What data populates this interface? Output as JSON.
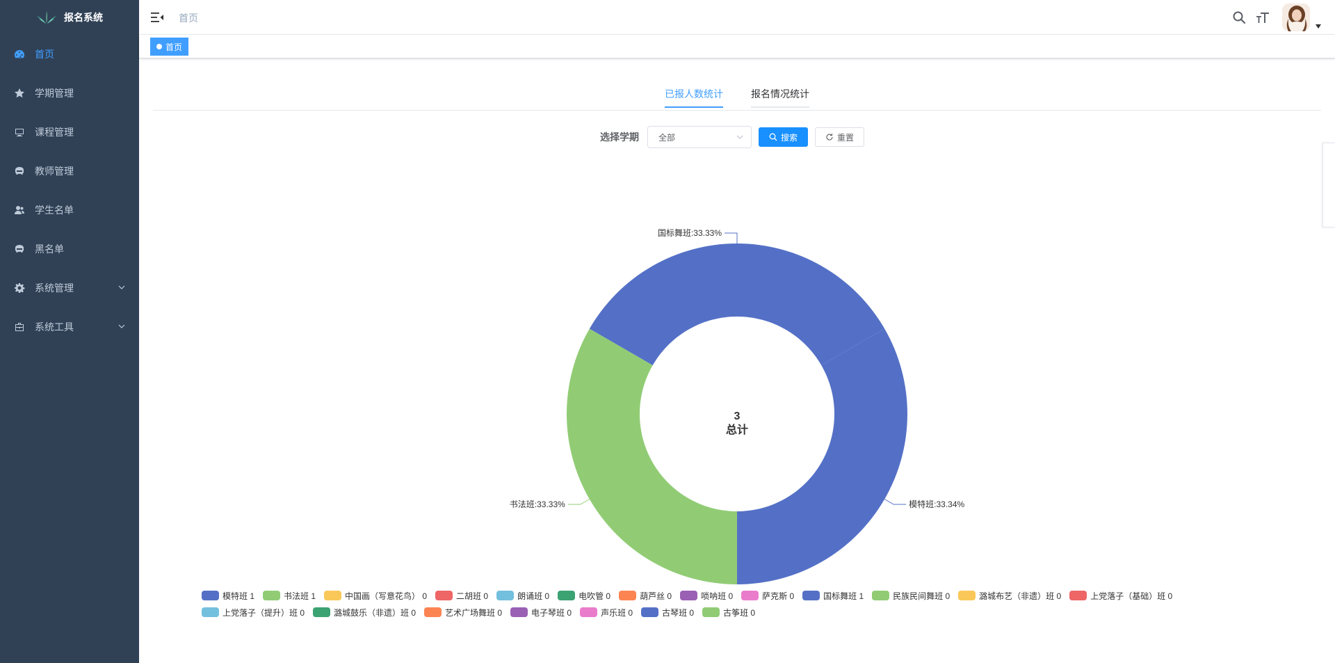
{
  "app": {
    "title": "报名系统"
  },
  "sidebar": {
    "items": [
      {
        "label": "首页",
        "icon": "dashboard-icon",
        "active": true
      },
      {
        "label": "学期管理",
        "icon": "star-icon"
      },
      {
        "label": "课程管理",
        "icon": "monitor-icon"
      },
      {
        "label": "教师管理",
        "icon": "education-icon"
      },
      {
        "label": "学生名单",
        "icon": "peoples-icon"
      },
      {
        "label": "黑名单",
        "icon": "education-icon"
      },
      {
        "label": "系统管理",
        "icon": "gear-icon",
        "expandable": true
      },
      {
        "label": "系统工具",
        "icon": "toolbox-icon",
        "expandable": true
      }
    ]
  },
  "header": {
    "breadcrumb": "首页"
  },
  "tags_view": {
    "tags": [
      {
        "label": "首页",
        "active": true
      }
    ]
  },
  "tabs": [
    {
      "label": "已报人数统计",
      "active": true
    },
    {
      "label": "报名情况统计",
      "active": false
    }
  ],
  "filter": {
    "label": "选择学期",
    "select_value": "全部",
    "search_label": "搜索",
    "reset_label": "重置"
  },
  "colors": {
    "accent": "#409eff",
    "sidebar_bg": "#304156",
    "primary_button": "#1890ff"
  },
  "chart_data": {
    "type": "pie",
    "variant": "donut",
    "center_text": {
      "value": "3",
      "label": "总计"
    },
    "slices": [
      {
        "name": "模特班",
        "value": 1,
        "label": "模特班:33.34%",
        "color": "#5470c6"
      },
      {
        "name": "书法班",
        "value": 1,
        "label": "书法班:33.33%",
        "color": "#91cc75"
      },
      {
        "name": "国标舞班",
        "value": 1,
        "label": "国标舞班:33.33%",
        "color": "#5470c6"
      }
    ],
    "legend": [
      {
        "name": "模特班",
        "value": 1,
        "color": "#5470c6"
      },
      {
        "name": "书法班",
        "value": 1,
        "color": "#91cc75"
      },
      {
        "name": "中国画（写意花鸟）",
        "value": 0,
        "color": "#fac858"
      },
      {
        "name": "二胡班",
        "value": 0,
        "color": "#ee6666"
      },
      {
        "name": "朗诵班",
        "value": 0,
        "color": "#73c0de"
      },
      {
        "name": "电吹管",
        "value": 0,
        "color": "#3ba272"
      },
      {
        "name": "葫芦丝",
        "value": 0,
        "color": "#fc8452"
      },
      {
        "name": "唢呐班",
        "value": 0,
        "color": "#9a60b4"
      },
      {
        "name": "萨克斯",
        "value": 0,
        "color": "#ea7ccc"
      },
      {
        "name": "国标舞班",
        "value": 1,
        "color": "#5470c6"
      },
      {
        "name": "民族民间舞班",
        "value": 0,
        "color": "#91cc75"
      },
      {
        "name": "潞城布艺（非遗）班",
        "value": 0,
        "color": "#fac858"
      },
      {
        "name": "上党落子（基础）班",
        "value": 0,
        "color": "#ee6666"
      },
      {
        "name": "上党落子（提升）班",
        "value": 0,
        "color": "#73c0de"
      },
      {
        "name": "潞城鼓乐（非遗）班",
        "value": 0,
        "color": "#3ba272"
      },
      {
        "name": "艺术广场舞班",
        "value": 0,
        "color": "#fc8452"
      },
      {
        "name": "电子琴班",
        "value": 0,
        "color": "#9a60b4"
      },
      {
        "name": "声乐班",
        "value": 0,
        "color": "#ea7ccc"
      },
      {
        "name": "古琴班",
        "value": 0,
        "color": "#5470c6"
      },
      {
        "name": "古筝班",
        "value": 0,
        "color": "#91cc75"
      }
    ],
    "legend_placement": "bottom"
  }
}
